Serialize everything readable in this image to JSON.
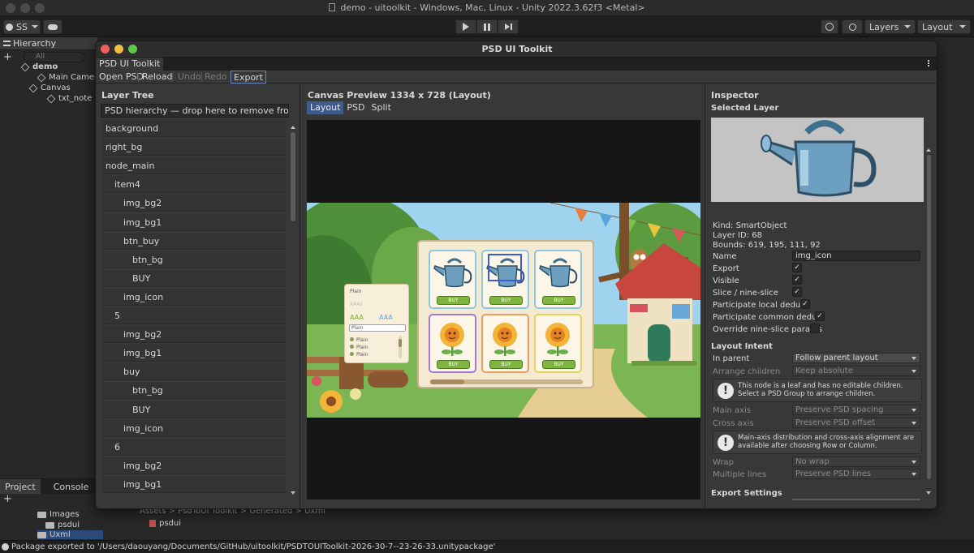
{
  "window_title": "demo - uitoolkit - Windows, Mac, Linux - Unity 2022.3.62f3 <Metal>",
  "toolbar": {
    "account_label": "SS",
    "layers_label": "Layers",
    "layout_label": "Layout"
  },
  "hierarchy": {
    "tab_label": "Hierarchy",
    "search_placeholder": "All",
    "items": [
      "demo",
      "Main Camera",
      "Canvas",
      "txt_note"
    ]
  },
  "project": {
    "tabs": [
      "Project",
      "Console"
    ],
    "folders": [
      "Images",
      "psdui",
      "Uxml"
    ],
    "breadcrumb": "Assets > PsdToUI Toolkit > Generated > Uxml",
    "file": "psdui"
  },
  "status_message": "Package exported to '/Users/daouyang/Documents/GitHub/uitoolkit/PSDTOUIToolkit-2026-30-7--23-26-33.unitypackage'",
  "psd_window": {
    "title": "PSD UI Toolkit",
    "tab_label": "PSD UI Toolkit",
    "toolbar": {
      "open_psd": "Open PSD",
      "reload": "Reload",
      "undo": "Undo",
      "redo": "Redo",
      "export": "Export"
    }
  },
  "layer_tree": {
    "title": "Layer Tree",
    "dropzone_text": "PSD hierarchy — drop here to remove from a virtual group",
    "rows": [
      "background",
      "right_bg",
      "node_main",
      "item4",
      "img_bg2",
      "img_bg1",
      "btn_buy",
      "btn_bg",
      "BUY",
      "img_icon",
      "5",
      "img_bg2",
      "img_bg1",
      "buy",
      "btn_bg",
      "BUY",
      "img_icon",
      "6",
      "img_bg2",
      "img_bg1"
    ],
    "indents": [
      0,
      0,
      0,
      1,
      2,
      2,
      2,
      3,
      3,
      2,
      1,
      2,
      2,
      2,
      3,
      3,
      2,
      1,
      2,
      2
    ]
  },
  "canvas_preview": {
    "title": "Canvas Preview  1334 x 728  (Layout)",
    "tabs": [
      "Layout",
      "PSD",
      "Split"
    ],
    "active_tab": "Layout",
    "shop": {
      "buy_label": "BUY",
      "items": [
        "watering-can",
        "watering-can",
        "watering-can",
        "sunflower",
        "sunflower",
        "sunflower"
      ],
      "style_panel": {
        "title": "Plain",
        "sample_faded": "AAAs",
        "sample_a": "AAA",
        "sample_b": "AAA",
        "input_value": "Plain",
        "radios": [
          "Plain",
          "Plain",
          "Plain"
        ]
      }
    }
  },
  "inspector": {
    "title": "Inspector",
    "selected_layer_label": "Selected Layer",
    "kind": "Kind: SmartObject",
    "layer_id": "Layer ID: 68",
    "bounds": "Bounds: 619, 195, 111, 92",
    "name_label": "Name",
    "name_value": "img_icon",
    "export_label": "Export",
    "visible_label": "Visible",
    "slice_label": "Slice / nine-slice",
    "local_dedup_label": "Participate local dedup",
    "common_dedup_label": "Participate common dedup",
    "override_label": "Override nine-slice params",
    "checked": "✓",
    "layout_intent_title": "Layout Intent",
    "in_parent_label": "In parent",
    "in_parent_value": "Follow parent layout",
    "arrange_label": "Arrange children",
    "arrange_value": "Keep absolute",
    "help_leaf": "This node is a leaf and has no editable children. Select a PSD Group to arrange children.",
    "main_axis_label": "Main axis",
    "main_axis_value": "Preserve PSD spacing",
    "cross_axis_label": "Cross axis",
    "cross_axis_value": "Preserve PSD offset",
    "help_axis": "Main-axis distribution and cross-axis alignment are available after choosing Row or Column.",
    "wrap_label": "Wrap",
    "wrap_value": "No wrap",
    "multiple_lines_label": "Multiple lines",
    "multiple_lines_value": "Preserve PSD lines",
    "export_settings_title": "Export Settings"
  }
}
